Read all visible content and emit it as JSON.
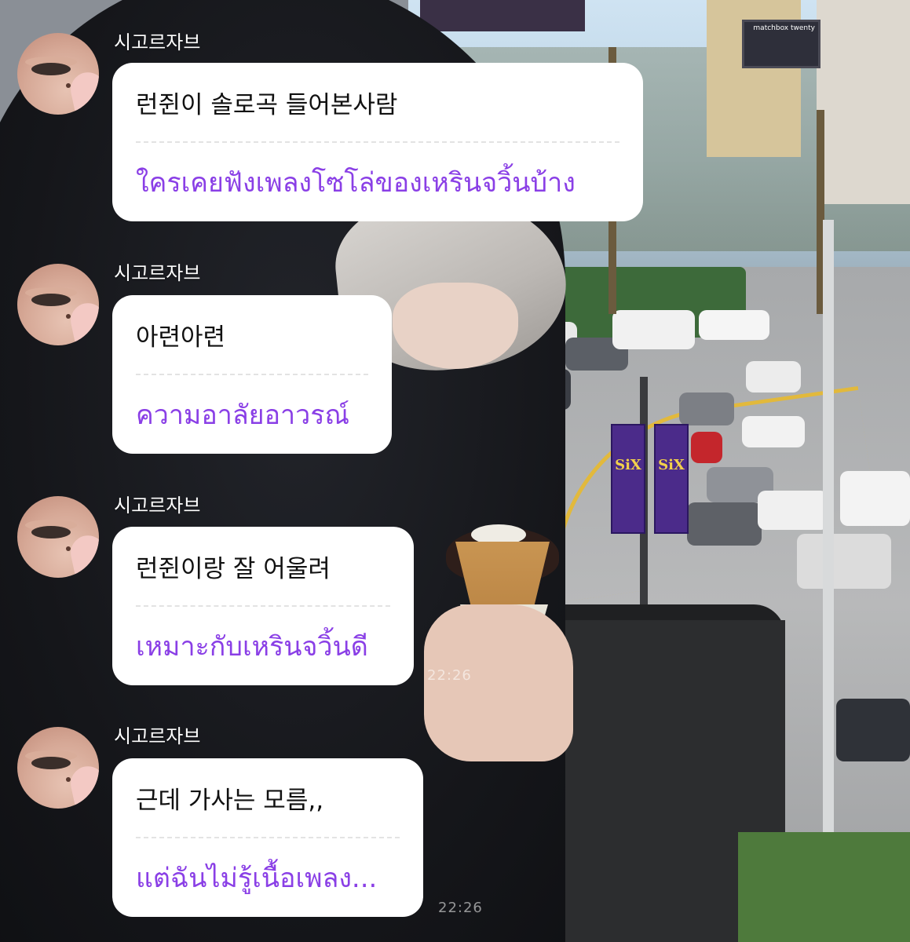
{
  "colors": {
    "bubble_bg": "#ffffff",
    "korean_text": "#111111",
    "thai_text": "#8a3fe6",
    "name_text": "#ffffff"
  },
  "photo": {
    "billboard_text": "matchbox twenty",
    "banner_text": "SiX",
    "timestamp_1": "22:26",
    "timestamp_2": "22:26"
  },
  "messages": [
    {
      "sender": "시고르자브",
      "korean": "런쥔이 솔로곡 들어본사람",
      "thai": "ใครเคยฟังเพลงโซโล่ของเหรินจวิ้นบ้าง"
    },
    {
      "sender": "시고르자브",
      "korean": "아련아련",
      "thai": "ความอาลัยอาวรณ์"
    },
    {
      "sender": "시고르자브",
      "korean": "런쥔이랑 잘 어울려",
      "thai": "เหมาะกับเหรินจวิ้นดี"
    },
    {
      "sender": "시고르자브",
      "korean": "근데 가사는 모름,,",
      "thai": "แต่ฉันไม่รู้เนื้อเพลง..."
    }
  ]
}
